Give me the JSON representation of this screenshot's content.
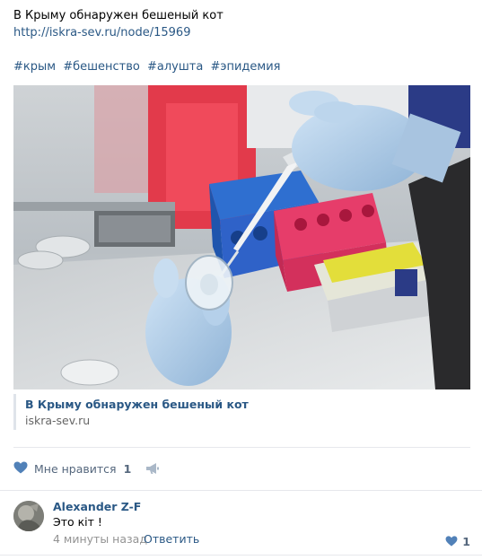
{
  "post": {
    "title": "В Крыму обнаружен бешеный кот",
    "link": "http://iskra-sev.ru/node/15969",
    "tags": [
      "#крым",
      "#бешенство",
      "#алушта",
      "#эпидемия"
    ],
    "snippet": {
      "title": "В Крыму обнаружен бешеный кот",
      "domain": "iskra-sev.ru"
    },
    "actions": {
      "like_label": "Мне нравится",
      "like_count": "1",
      "like_icon": "heart-icon",
      "share_icon": "megaphone-icon"
    }
  },
  "comment": {
    "author": "Alexander Z-F",
    "text": "Это кіт !",
    "time": "4 минуты назад",
    "reply_label": "Ответить",
    "like_count": "1",
    "like_icon": "heart-icon"
  },
  "colors": {
    "link": "#2a5885",
    "muted": "#55677d",
    "time": "#939393",
    "divider": "#e7e8ec"
  }
}
